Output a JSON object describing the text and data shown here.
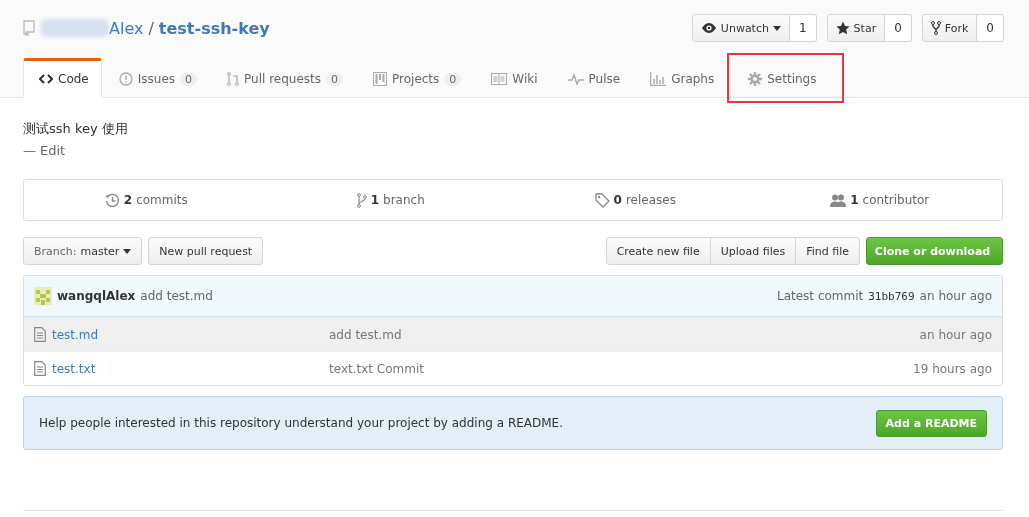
{
  "repo": {
    "owner": "Alex",
    "separator": "/",
    "name": "test-ssh-key"
  },
  "actions": [
    {
      "kind": "watch",
      "label": "Unwatch",
      "count": "1",
      "dropdown": true
    },
    {
      "kind": "star",
      "label": "Star",
      "count": "0",
      "dropdown": false
    },
    {
      "kind": "fork",
      "label": "Fork",
      "count": "0",
      "dropdown": false
    }
  ],
  "tabs": [
    {
      "kind": "code",
      "label": "Code",
      "selected": true,
      "highlighted": false
    },
    {
      "kind": "issues",
      "label": "Issues",
      "counter": "0",
      "selected": false,
      "highlighted": false
    },
    {
      "kind": "pulls",
      "label": "Pull requests",
      "counter": "0",
      "selected": false,
      "highlighted": false
    },
    {
      "kind": "projects",
      "label": "Projects",
      "counter": "0",
      "selected": false,
      "highlighted": false
    },
    {
      "kind": "wiki",
      "label": "Wiki",
      "selected": false,
      "highlighted": false
    },
    {
      "kind": "pulse",
      "label": "Pulse",
      "selected": false,
      "highlighted": false
    },
    {
      "kind": "graphs",
      "label": "Graphs",
      "selected": false,
      "highlighted": false
    },
    {
      "kind": "settings",
      "label": "Settings",
      "selected": false,
      "highlighted": true
    }
  ],
  "description": {
    "text": "测试ssh key 使用",
    "dash": "—",
    "edit": "Edit"
  },
  "summary": [
    {
      "kind": "commits",
      "count": "2",
      "label": "commits"
    },
    {
      "kind": "branch",
      "count": "1",
      "label": "branch"
    },
    {
      "kind": "releases",
      "count": "0",
      "label": "releases"
    },
    {
      "kind": "contributors",
      "count": "1",
      "label": "contributor"
    }
  ],
  "branch": {
    "label": "Branch:",
    "name": "master"
  },
  "new_pull_request": "New pull request",
  "file_buttons": [
    "Create new file",
    "Upload files",
    "Find file"
  ],
  "clone_button": "Clone or download",
  "commit": {
    "author": "wangqlAlex",
    "message": "add test.md",
    "latest_label": "Latest commit",
    "sha": "31bb769",
    "time": "an hour ago"
  },
  "files": [
    {
      "name": "test.md",
      "message": "add test.md",
      "time": "an hour ago",
      "highlighted": true
    },
    {
      "name": "test.txt",
      "message": "text.txt Commit",
      "time": "19 hours ago",
      "highlighted": false
    }
  ],
  "readme_notice": {
    "text": "Help people interested in this repository understand your project by adding a README.",
    "button": "Add a README"
  }
}
